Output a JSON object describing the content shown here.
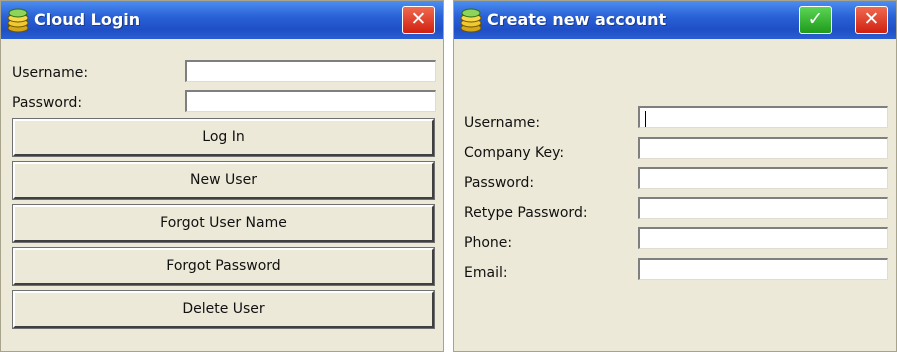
{
  "login_window": {
    "title": "Cloud Login",
    "close_symbol": "✕",
    "fields": [
      {
        "label": "Username:",
        "value": ""
      },
      {
        "label": "Password:",
        "value": ""
      }
    ],
    "buttons": [
      "Log In",
      "New User",
      "Forgot User Name",
      "Forgot Password",
      "Delete User"
    ]
  },
  "create_window": {
    "title": "Create new account",
    "ok_symbol": "✓",
    "close_symbol": "✕",
    "fields": [
      {
        "label": "Username:",
        "value": ""
      },
      {
        "label": "Company Key:",
        "value": ""
      },
      {
        "label": "Password:",
        "value": ""
      },
      {
        "label": "Retype Password:",
        "value": ""
      },
      {
        "label": "Phone:",
        "value": ""
      },
      {
        "label": "Email:",
        "value": ""
      }
    ]
  },
  "colors": {
    "titlebar": "#2a62d8",
    "window_background": "#ece9d8",
    "close_button": "#d02010",
    "ok_button": "#1f9a1a"
  },
  "icons": {
    "app": "cloud-coins-icon",
    "close": "close-icon",
    "ok": "checkmark-icon"
  }
}
